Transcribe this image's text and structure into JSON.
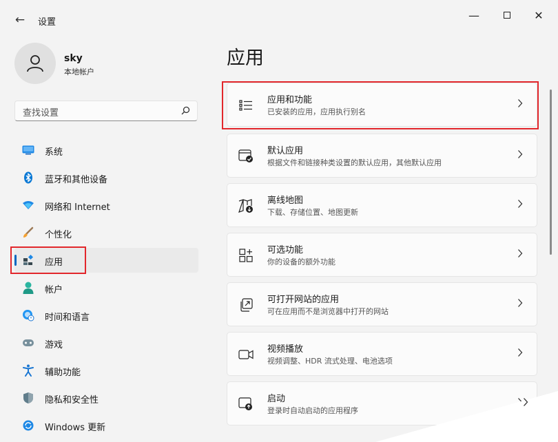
{
  "window": {
    "title": "设置"
  },
  "user": {
    "name": "sky",
    "account_type": "本地帐户"
  },
  "search": {
    "placeholder": "查找设置"
  },
  "nav": {
    "items": [
      {
        "label": "系统",
        "icon": "monitor-icon"
      },
      {
        "label": "蓝牙和其他设备",
        "icon": "bluetooth-icon"
      },
      {
        "label": "网络和 Internet",
        "icon": "wifi-icon"
      },
      {
        "label": "个性化",
        "icon": "brush-icon"
      },
      {
        "label": "应用",
        "icon": "apps-icon",
        "selected": true
      },
      {
        "label": "帐户",
        "icon": "account-icon"
      },
      {
        "label": "时间和语言",
        "icon": "globe-clock-icon"
      },
      {
        "label": "游戏",
        "icon": "gamepad-icon"
      },
      {
        "label": "辅助功能",
        "icon": "accessibility-icon"
      },
      {
        "label": "隐私和安全性",
        "icon": "shield-icon"
      },
      {
        "label": "Windows 更新",
        "icon": "update-icon"
      }
    ]
  },
  "main": {
    "title": "应用",
    "cards": [
      {
        "title": "应用和功能",
        "subtitle": "已安装的应用，应用执行别名",
        "icon": "list-icon"
      },
      {
        "title": "默认应用",
        "subtitle": "根据文件和链接种类设置的默认应用，其他默认应用",
        "icon": "default-apps-icon"
      },
      {
        "title": "离线地图",
        "subtitle": "下载、存储位置、地图更新",
        "icon": "map-download-icon"
      },
      {
        "title": "可选功能",
        "subtitle": "你的设备的额外功能",
        "icon": "optional-features-icon"
      },
      {
        "title": "可打开网站的应用",
        "subtitle": "可在应用而不是浏览器中打开的网站",
        "icon": "open-website-icon"
      },
      {
        "title": "视频播放",
        "subtitle": "视频调整、HDR 流式处理、电池选项",
        "icon": "video-icon"
      },
      {
        "title": "启动",
        "subtitle": "登录时自动启动的应用程序",
        "icon": "startup-icon"
      }
    ]
  },
  "colors": {
    "accent": "#0067c0",
    "highlight_box": "#e2262b",
    "background": "#f3f3f3",
    "card": "#fbfbfb"
  }
}
